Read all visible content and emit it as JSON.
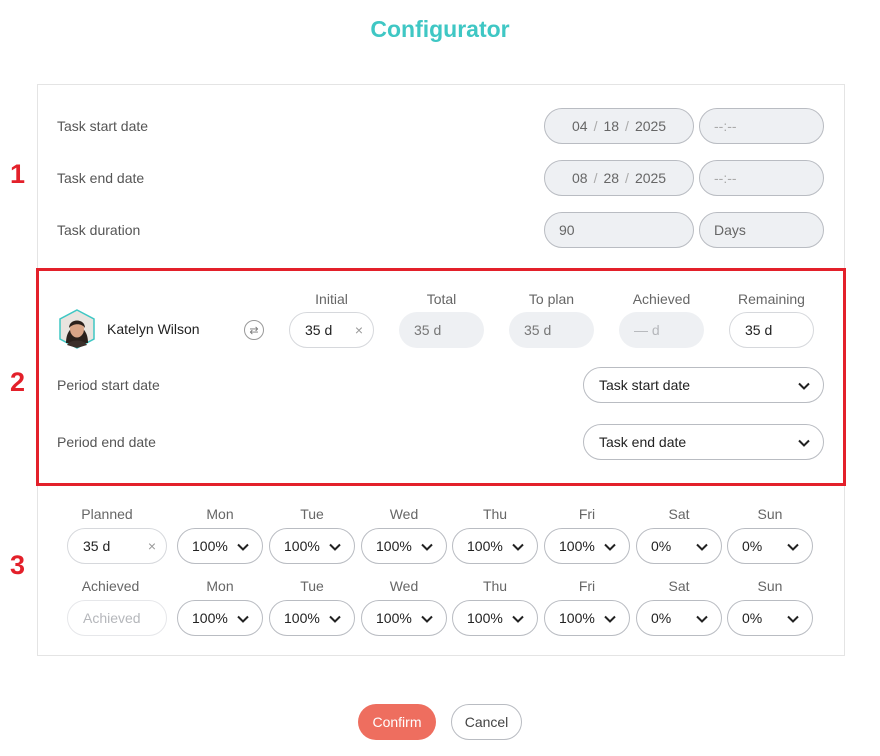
{
  "title": "Configurator",
  "markers": [
    "1",
    "2",
    "3"
  ],
  "section1": {
    "start_label": "Task start date",
    "start_month": "04",
    "start_day": "18",
    "start_year": "2025",
    "start_time": "--:--",
    "end_label": "Task end date",
    "end_month": "08",
    "end_day": "28",
    "end_year": "2025",
    "end_time": "--:--",
    "duration_label": "Task duration",
    "duration_value": "90",
    "duration_unit": "Days",
    "date_sep": "/"
  },
  "section2": {
    "user_name": "Katelyn Wilson",
    "columns": {
      "initial": "Initial",
      "total": "Total",
      "to_plan": "To plan",
      "achieved": "Achieved",
      "remaining": "Remaining"
    },
    "values": {
      "initial": "35 d",
      "total": "35 d",
      "to_plan": "35 d",
      "achieved_placeholder": "— d",
      "remaining": "35 d"
    },
    "clear_icon": "×",
    "period_start_label": "Period start date",
    "period_start_value": "Task start date",
    "period_end_label": "Period end date",
    "period_end_value": "Task end date"
  },
  "section3": {
    "days": [
      "Mon",
      "Tue",
      "Wed",
      "Thu",
      "Fri",
      "Sat",
      "Sun"
    ],
    "planned_label": "Planned",
    "planned_value": "35 d",
    "planned_days": [
      "100%",
      "100%",
      "100%",
      "100%",
      "100%",
      "0%",
      "0%"
    ],
    "achieved_label": "Achieved",
    "achieved_placeholder": "Achieved",
    "achieved_days": [
      "100%",
      "100%",
      "100%",
      "100%",
      "100%",
      "0%",
      "0%"
    ]
  },
  "footer": {
    "confirm": "Confirm",
    "cancel": "Cancel"
  },
  "colors": {
    "title": "#3fc7c4",
    "marker": "#e3202a",
    "confirm": "#ee6e5f"
  }
}
